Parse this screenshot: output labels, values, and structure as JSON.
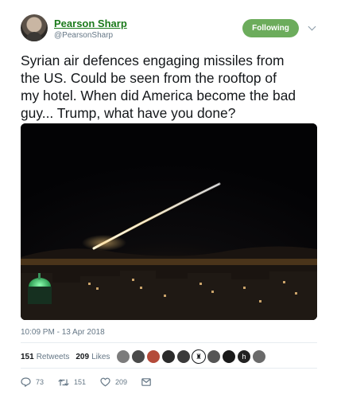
{
  "user": {
    "name": "Pearson Sharp",
    "handle": "@PearsonSharp"
  },
  "follow_button": {
    "label": "Following",
    "color": "#6cac5c"
  },
  "tweet": {
    "text": "Syrian air defences engaging missiles from\nthe US. Could be seen from the rooftop of\nmy hotel. When did America become the bad\nguy... Trump, what have you done?",
    "timestamp": "10:09 PM - 13 Apr 2018"
  },
  "photo": {
    "icon": "night-city-missile-photo"
  },
  "stats": {
    "retweets_count": "151",
    "retweets_label": "Retweets",
    "likes_count": "209",
    "likes_label": "Likes"
  },
  "likers": [
    {
      "icon": "avatar-1",
      "color": "#7c7c7c",
      "glyph": ""
    },
    {
      "icon": "avatar-2",
      "color": "#4a4a4a",
      "glyph": ""
    },
    {
      "icon": "avatar-3",
      "color": "#b44b3a",
      "glyph": ""
    },
    {
      "icon": "avatar-4",
      "color": "#2b2b2b",
      "glyph": ""
    },
    {
      "icon": "avatar-5",
      "color": "#3a3a3a",
      "glyph": ""
    },
    {
      "icon": "avatar-6",
      "color": "#ffffff",
      "glyph": "♜"
    },
    {
      "icon": "avatar-7",
      "color": "#555555",
      "glyph": ""
    },
    {
      "icon": "avatar-8",
      "color": "#1a1a1a",
      "glyph": ""
    },
    {
      "icon": "avatar-9",
      "color": "#222222",
      "glyph": "h"
    },
    {
      "icon": "avatar-10",
      "color": "#6a6a6a",
      "glyph": ""
    }
  ],
  "actions": {
    "reply_count": "73",
    "retweet_count": "151",
    "like_count": "209"
  }
}
